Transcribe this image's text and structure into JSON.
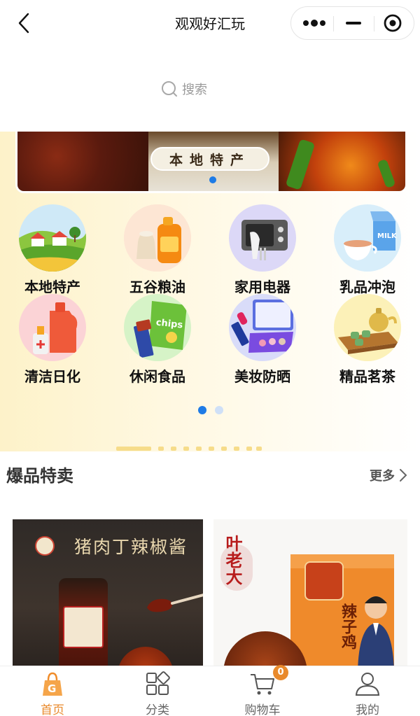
{
  "header": {
    "title": "观观好汇玩",
    "back_icon": "chevron-left-icon",
    "capsule_icons": [
      "more-dots-icon",
      "minimize-icon",
      "target-icon"
    ]
  },
  "search": {
    "placeholder": "搜索",
    "icon": "search-icon"
  },
  "banner": {
    "tag_text": "本地特产",
    "active_slide": 1
  },
  "categories": {
    "items": [
      {
        "label": "本地特产",
        "icon": "farmland-icon"
      },
      {
        "label": "五谷粮油",
        "icon": "grain-oil-icon"
      },
      {
        "label": "家用电器",
        "icon": "appliance-icon"
      },
      {
        "label": "乳品冲泡",
        "icon": "milk-icon"
      },
      {
        "label": "清洁日化",
        "icon": "detergent-icon"
      },
      {
        "label": "休闲食品",
        "icon": "snack-icon"
      },
      {
        "label": "美妆防晒",
        "icon": "makeup-icon"
      },
      {
        "label": "精品茗茶",
        "icon": "tea-icon"
      }
    ],
    "pages": 2,
    "current_page": 1
  },
  "section": {
    "title": "爆品特卖",
    "more_label": "更多"
  },
  "products": [
    {
      "title": "猪肉丁辣椒酱"
    },
    {
      "brand": "叶老大",
      "name": "辣子鸡"
    }
  ],
  "tabbar": {
    "items": [
      {
        "label": "首页",
        "icon": "home-bag-icon",
        "active": true
      },
      {
        "label": "分类",
        "icon": "grid-icon",
        "active": false
      },
      {
        "label": "购物车",
        "icon": "cart-icon",
        "active": false,
        "badge": "0"
      },
      {
        "label": "我的",
        "icon": "user-icon",
        "active": false
      }
    ]
  },
  "colors": {
    "accent": "#e98a2c",
    "dot_active": "#1e7be6",
    "dot_inactive": "#cfe0f7"
  }
}
